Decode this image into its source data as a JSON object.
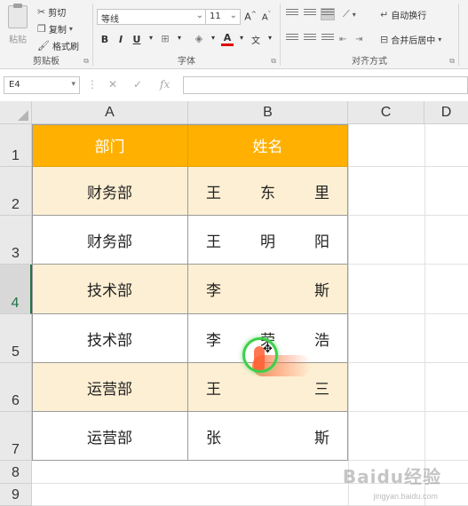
{
  "ribbon": {
    "clipboard": {
      "paste_label": "粘贴",
      "cut_label": "剪切",
      "copy_label": "复制",
      "format_painter_label": "格式刷",
      "group_label": "剪贴板"
    },
    "font": {
      "font_name": "等线",
      "font_size": "11",
      "grow_label": "A",
      "shrink_label": "A",
      "bold_label": "B",
      "italic_label": "I",
      "underline_label": "U",
      "font_color_label": "A",
      "phonetic_label": "文",
      "group_label": "字体"
    },
    "alignment": {
      "wrap_text_label": "自动换行",
      "merge_center_label": "合并后居中",
      "group_label": "对齐方式"
    }
  },
  "formula_bar": {
    "name_box": "E4",
    "fx_label": "fx",
    "formula": ""
  },
  "sheet": {
    "columns": [
      "A",
      "B",
      "C",
      "D"
    ],
    "rows": [
      "1",
      "2",
      "3",
      "4",
      "5",
      "6",
      "7",
      "8",
      "9"
    ],
    "header_row": {
      "department": "部门",
      "name": "姓名"
    },
    "data_rows": [
      {
        "department": "财务部",
        "name_chars": [
          "王",
          "东",
          "里"
        ]
      },
      {
        "department": "财务部",
        "name_chars": [
          "王",
          "明",
          "阳"
        ]
      },
      {
        "department": "技术部",
        "name_chars": [
          "李",
          "",
          "斯"
        ]
      },
      {
        "department": "技术部",
        "name_chars": [
          "李",
          "荣",
          "浩"
        ]
      },
      {
        "department": "运营部",
        "name_chars": [
          "王",
          "",
          "三"
        ]
      },
      {
        "department": "运营部",
        "name_chars": [
          "张",
          "",
          "斯"
        ]
      }
    ]
  },
  "colors": {
    "header_fill": "#ffb000",
    "band_fill": "#fdefd3",
    "excel_green": "#217346"
  },
  "watermark": {
    "text": "Baidu经验",
    "sub": "jingyan.baidu.com"
  }
}
